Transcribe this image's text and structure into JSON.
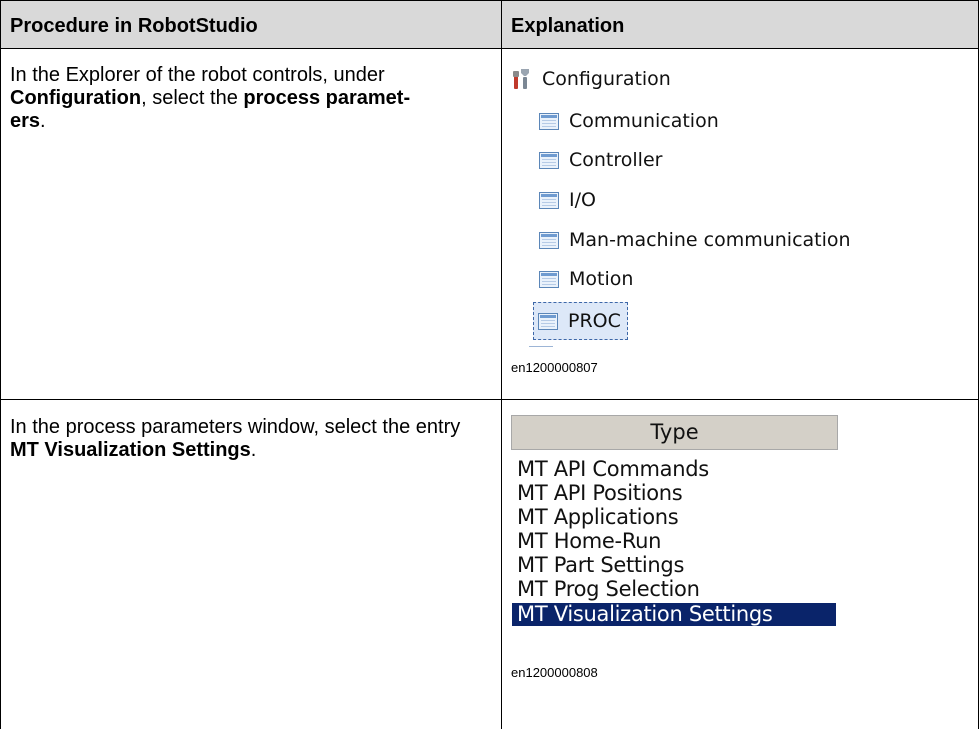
{
  "table": {
    "headers": [
      "Procedure in RobotStudio",
      "Explanation"
    ],
    "rows": [
      {
        "procedure_parts": [
          "In the Explorer of the robot controls, under ",
          "Configuration",
          ", select the ",
          "process paramet-",
          "ers",
          "."
        ],
        "figure": {
          "root": {
            "label": "Configuration",
            "icon": "configuration-tools-icon"
          },
          "items": [
            "Communication",
            "Controller",
            "I/O",
            "Man-machine communication",
            "Motion",
            "PROC"
          ],
          "selected": "PROC",
          "caption": "en1200000807"
        }
      },
      {
        "procedure_parts": [
          "In the process parameters window, select the entry ",
          "MT Visualization Settings",
          "."
        ],
        "figure": {
          "column_header": "Type",
          "items": [
            "MT API Commands",
            "MT API Positions",
            "MT Applications",
            "MT Home-Run",
            "MT Part Settings",
            "MT Prog Selection",
            "MT Visualization Settings"
          ],
          "selected": "MT Visualization Settings",
          "caption": "en1200000808"
        }
      }
    ]
  }
}
